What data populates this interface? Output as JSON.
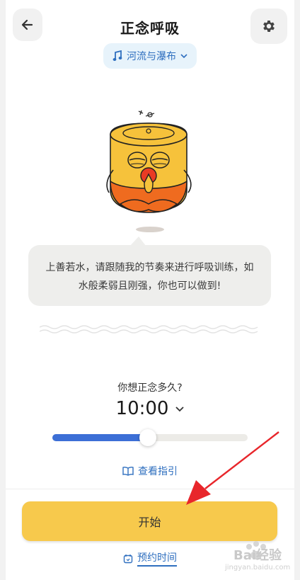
{
  "header": {
    "title": "正念呼吸",
    "back_icon": "arrow-left-icon",
    "settings_icon": "gear-icon"
  },
  "music": {
    "icon": "music-note-icon",
    "track": "河流与瀑布",
    "chevron": "chevron-down-icon"
  },
  "mascot": {
    "icon": "meditating-mascot-icon"
  },
  "bubble": {
    "line1": "上善若水，请跟随我的节奏来进行呼吸训练，如",
    "line2": "水般柔弱且刚强，你也可以做到!"
  },
  "duration": {
    "question": "你想正念多久?",
    "value": "10:00",
    "chevron": "chevron-down-icon",
    "slider_fraction": 0.49
  },
  "guide": {
    "icon": "book-icon",
    "label": "查看指引"
  },
  "start": {
    "label": "开始"
  },
  "schedule": {
    "icon": "calendar-clock-icon",
    "label": "预约时间"
  },
  "colors": {
    "accent_blue": "#3c6fd6",
    "link_blue": "#2f6fbf",
    "start_yellow": "#f7c94c",
    "annotation_red": "#e8262b"
  },
  "watermark": {
    "brand": "Bai",
    "brand_cn": "经验",
    "url": "jingyan.baidu.com"
  }
}
